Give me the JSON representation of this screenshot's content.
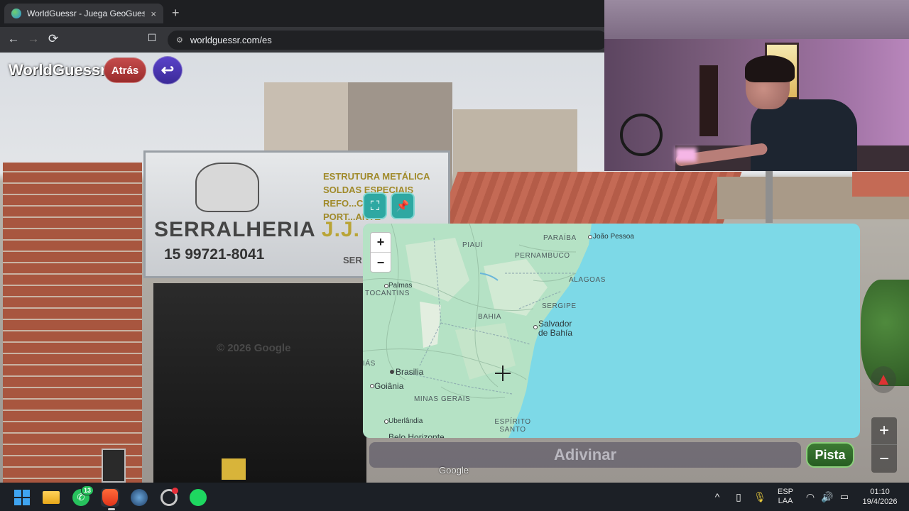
{
  "browser": {
    "tab_title": "WorldGuessr - Juega GeoGuessr",
    "tab_close": "×",
    "new_tab": "+",
    "back": "←",
    "forward": "→",
    "reload": "⟳",
    "bookmark": "☐",
    "url": "worldguessr.com/es"
  },
  "game": {
    "logo": "WorldGuessr",
    "back_label": "Atrás",
    "return_icon": "↩",
    "guess_label": "Adivinar",
    "hint_label": "Pista",
    "expand_icon": "⛶",
    "pin_icon": "📌",
    "copyright": "© 2026 Google",
    "google_logo": "Google",
    "sv_zoom_in": "+",
    "sv_zoom_out": "−"
  },
  "sign": {
    "brand": "SERRALHERIA",
    "brand_suffix": "J.J.",
    "phone": "15 99721-8041",
    "services": [
      "ESTRUTURA METÁLICA",
      "SOLDAS ESPECIAIS",
      "REFO...COLA",
      "PORT...ANTE"
    ],
    "fragment": "SER"
  },
  "map": {
    "zoom_in": "+",
    "zoom_out": "−",
    "regions": [
      "PARAÍBA",
      "PIAUÍ",
      "PERNAMBUCO",
      "ALAGOAS",
      "TOCANTINS",
      "SERGIPE",
      "BAHIA",
      "MINAS GERAIS",
      "ESPÍRITO SANTO",
      "IÁS"
    ],
    "cities": {
      "joao_pessoa": "João Pessoa",
      "palmas": "Palmas",
      "salvador_1": "Salvador",
      "salvador_2": "de Bahía",
      "brasilia": "Brasilia",
      "goiania": "Goiânia",
      "uberlandia": "Uberlândia",
      "belo_horizonte": "Belo Horizonte"
    }
  },
  "taskbar": {
    "whatsapp_badge": "13",
    "tray_chevron": "^",
    "lang_1": "ESP",
    "lang_2": "LAA",
    "time": "01:10",
    "date": "19/4/2026"
  },
  "colors": {
    "ocean": "#7dd9e7",
    "land": "#b5e2c5",
    "back_button": "#b13b3b",
    "return_button": "#4a35b0",
    "hint_button": "#2f6b2a",
    "map_buttons": "#2ea8a2"
  }
}
